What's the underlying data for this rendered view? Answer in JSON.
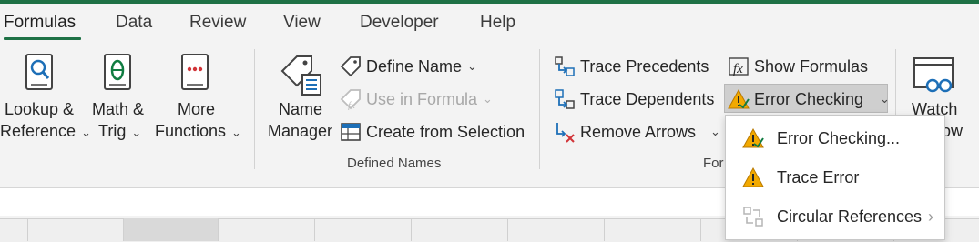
{
  "tabs": [
    "Formulas",
    "Data",
    "Review",
    "View",
    "Developer",
    "Help"
  ],
  "function_library": {
    "lookup": [
      "Lookup &",
      "Reference"
    ],
    "math": [
      "Math &",
      "Trig"
    ],
    "more": [
      "More",
      "Functions"
    ]
  },
  "defined_names": {
    "name_manager": [
      "Name",
      "Manager"
    ],
    "define_name": "Define Name",
    "use_in_formula": "Use in Formula",
    "create_from_selection": "Create from Selection",
    "group_label": "Defined Names"
  },
  "formula_auditing": {
    "trace_precedents": "Trace Precedents",
    "trace_dependents": "Trace Dependents",
    "remove_arrows": "Remove Arrows",
    "show_formulas": "Show Formulas",
    "error_checking": "Error Checking",
    "group_label_partial": "For"
  },
  "watch": [
    "Watch",
    "ow"
  ],
  "dropdown": {
    "items": [
      {
        "label": "Error Checking...",
        "icon": "error-checking-icon",
        "enabled": true
      },
      {
        "label": "Trace Error",
        "icon": "warning-icon",
        "enabled": true
      },
      {
        "label": "Circular References",
        "icon": "circular-references-icon",
        "enabled": false
      }
    ]
  },
  "colors": {
    "accent": "#1e7145",
    "ribbon_bg": "#f3f3f3",
    "warning": "#f2a900",
    "icon_blue": "#1d6fb7",
    "icon_red": "#d13438",
    "icon_green": "#107c41"
  }
}
